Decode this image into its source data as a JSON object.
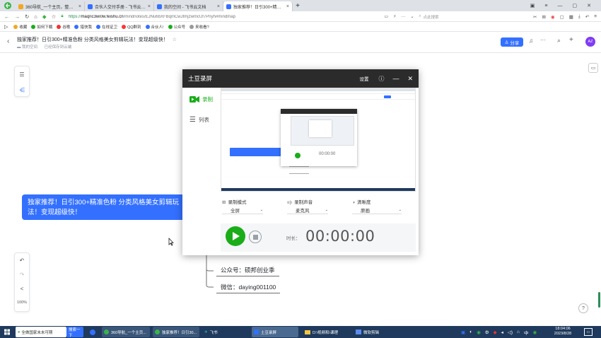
{
  "browser": {
    "tabs": [
      {
        "title": "360导航_一个主页，整个世界",
        "active": false,
        "color": "#f5a623"
      },
      {
        "title": "合伙人交付手册 - 飞书云文档",
        "active": false,
        "color": "#3370ff"
      },
      {
        "title": "我的空间 - 飞书云文档",
        "active": false,
        "color": "#3370ff"
      },
      {
        "title": "独家推荐！日引300+精准色",
        "active": true,
        "color": "#3370ff"
      }
    ],
    "new_tab": "+",
    "url_prefix": "https://",
    "url_host": "maqric3wi0w.feishu.cn",
    "url_path": "/mindnotes/EJNu6bXFBqmCwJtmjzwmcUf7Pnyh#mindmap",
    "search_placeholder": "点此搜索",
    "bookmarks": [
      {
        "label": "收藏",
        "color": "#f5a623"
      },
      {
        "label": "如何下载",
        "color": "#1aad19"
      },
      {
        "label": "谷歌",
        "color": "#e33"
      },
      {
        "label": "猎快我",
        "color": "#3370ff"
      },
      {
        "label": "在线证卫",
        "color": "#3370ff"
      },
      {
        "label": "QQ群到",
        "color": "#f33"
      },
      {
        "label": "合伙人!",
        "color": "#3370ff"
      },
      {
        "label": "公众号",
        "color": "#1aad19"
      },
      {
        "label": "来收看?",
        "color": "#999"
      }
    ]
  },
  "doc": {
    "title": "独家推荐！日引300+精准色粉 分类风格美女剪辑玩法！变现超级快！",
    "breadcrumb_space": "我的空间",
    "breadcrumb_saved": "已经保存到云端",
    "share_label": "分享",
    "avatar_text": "AZ"
  },
  "mindmap": {
    "root_text": "独家推荐！日引300+精准色粉 分类风格美女剪辑玩法！变现超级快！",
    "children": [
      "公众号：硕邦创业季",
      "微信：daying001100"
    ],
    "zoom": "100%"
  },
  "recorder": {
    "title": "土豆录屏",
    "settings_label": "设置",
    "nav": [
      {
        "label": "录制",
        "active": true
      },
      {
        "label": "列表",
        "active": false
      }
    ],
    "mode": {
      "label": "录制模式",
      "value": "全屏"
    },
    "audio": {
      "label": "录制声音",
      "value": "麦克风"
    },
    "quality": {
      "label": "清晰度",
      "value": "原画"
    },
    "duration_label": "时长：",
    "duration": "00:00:00",
    "preview_time": "00:00:00",
    "accent": "#1aad19"
  },
  "taskbar": {
    "items": [
      {
        "label": "全做国家未未可期"
      },
      {
        "label": "搜索一下"
      },
      {
        "label": "360导航_一个主页..."
      },
      {
        "label": "独家推荐！日引30..."
      },
      {
        "label": "飞书"
      },
      {
        "label": "土豆录屏"
      },
      {
        "label": "D:\\视频和\\课理"
      },
      {
        "label": "微软剪辑"
      }
    ],
    "time": "18:04:06",
    "date": "2023/8/28"
  }
}
